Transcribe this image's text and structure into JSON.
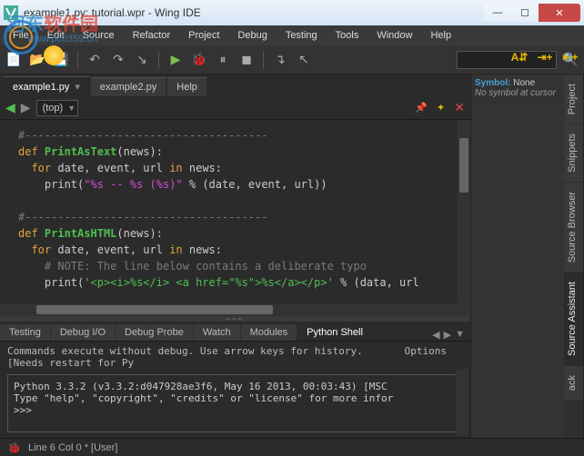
{
  "window": {
    "title": "example1.py: tutorial.wpr - Wing IDE",
    "buttons": {
      "min": "—",
      "max": "☐",
      "close": "✕"
    }
  },
  "watermark": {
    "text1": "河东",
    "text2": "软件园",
    "url": "www.pc0359.cn"
  },
  "menu": [
    "File",
    "Edit",
    "Source",
    "Refactor",
    "Project",
    "Debug",
    "Testing",
    "Tools",
    "Window",
    "Help"
  ],
  "right_toolbar": [
    "A⇵",
    "⇥+",
    "⇤+"
  ],
  "file_tabs": [
    {
      "label": "example1.py",
      "active": true
    },
    {
      "label": "example2.py",
      "active": false
    },
    {
      "label": "Help",
      "active": false
    }
  ],
  "nav": {
    "back": "◀",
    "fwd": "▶",
    "scope": "(top)",
    "pin": "📌",
    "star": "✦",
    "close": "✕"
  },
  "code": {
    "l1": "#-------------------------------------",
    "l2a": "def",
    "l2b": "PrintAsText",
    "l2c": "(news):",
    "l3a": "for",
    "l3b": " date, event, url ",
    "l3c": "in",
    "l3d": " news:",
    "l4a": "print(",
    "l4b": "\"%s -- %s (%s)\"",
    "l4c": " % (date, event, url))",
    "l5": "#-------------------------------------",
    "l6a": "def",
    "l6b": "PrintAsHTML",
    "l6c": "(news):",
    "l7a": "for",
    "l7b": " date, event, url ",
    "l7c": "in",
    "l7d": " news:",
    "l8": "# NOTE: The line below contains a deliberate typo",
    "l9a": "print(",
    "l9b": "'<p><i>%s</i> <a href=\"%s\">%s</a></p>'",
    "l9c": " % (data, url"
  },
  "bottom_tabs": [
    "Testing",
    "Debug I/O",
    "Debug Probe",
    "Watch",
    "Modules",
    "Python Shell"
  ],
  "bottom_active": "Python Shell",
  "shell": {
    "hint": "Commands execute without debug.  Use arrow keys for history.  [Needs restart for Py",
    "options": "Options",
    "line1": "Python 3.3.2 (v3.3.2:d047928ae3f6, May 16 2013, 00:03:43) [MSC",
    "line2": "Type \"help\", \"copyright\", \"credits\" or \"license\" for more infor",
    "prompt": ">>>"
  },
  "side_tabs": [
    "Project",
    "Snippets",
    "Source Browser",
    "Source Assistant",
    "ack"
  ],
  "side_active": "Source Assistant",
  "symbol_panel": {
    "label": "Symbol:",
    "value": "None",
    "hint": "No symbol at cursor"
  },
  "status": {
    "pos": "Line 6 Col 0 * [User]"
  }
}
